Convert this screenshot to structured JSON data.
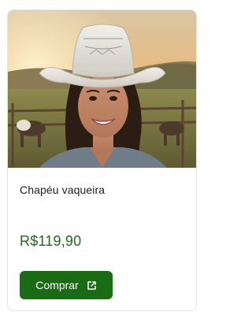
{
  "product": {
    "image_alt": "Mulher sorrindo usando chapéu de vaqueira branco em uma fazenda",
    "title": "Chapéu vaqueira",
    "price": "R$119,90",
    "buy_label": "Comprar",
    "buy_icon": "external-link-icon"
  },
  "colors": {
    "price": "#1d6a1d",
    "button": "#1a6c14",
    "border": "#e3e3e3"
  }
}
